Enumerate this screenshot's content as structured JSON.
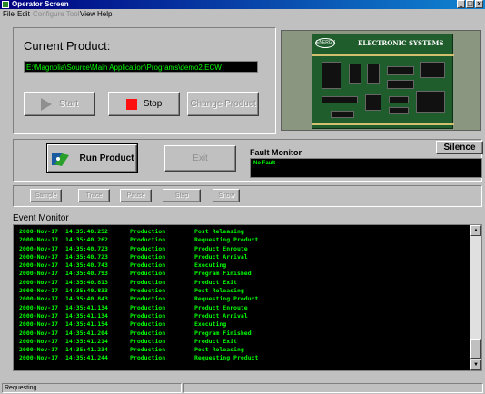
{
  "window": {
    "title": "Operator Screen",
    "min": "_",
    "max": "□",
    "close": "×"
  },
  "menu": {
    "items": [
      "File",
      "Edit",
      "Configure Tool",
      "View",
      "Help"
    ]
  },
  "product": {
    "label": "Current Product:",
    "path": "E:\\Magnolia\\Source\\Main Application\\Programs\\demo2.ECW",
    "image_brand": "ELECTRONIC SYSTEMS",
    "image_logo": "ENERGY"
  },
  "buttons": {
    "start": "Start",
    "stop": "Stop",
    "change_product": "Change Product",
    "run_product": "Run Product",
    "exit": "Exit",
    "silence": "Silence"
  },
  "fault": {
    "title": "Fault Monitor",
    "status": "No Fault"
  },
  "toolbar": {
    "buttons": [
      "Sample",
      "Trace",
      "Pause",
      "Step",
      "Show"
    ]
  },
  "events": {
    "title": "Event Monitor",
    "rows": [
      [
        "2000-Nov-17",
        "14:35:40.252",
        "Production",
        "Post Releasing"
      ],
      [
        "2000-Nov-17",
        "14:35:40.262",
        "Production",
        "Requesting Product"
      ],
      [
        "2000-Nov-17",
        "14:35:40.723",
        "Production",
        "Product Enroute"
      ],
      [
        "2000-Nov-17",
        "14:35:40.723",
        "Production",
        "Product Arrival"
      ],
      [
        "2000-Nov-17",
        "14:35:40.743",
        "Production",
        "Executing"
      ],
      [
        "2000-Nov-17",
        "14:35:40.793",
        "Production",
        "Program Finished"
      ],
      [
        "2000-Nov-17",
        "14:35:40.813",
        "Production",
        "Product Exit"
      ],
      [
        "2000-Nov-17",
        "14:35:40.833",
        "Production",
        "Post Releasing"
      ],
      [
        "2000-Nov-17",
        "14:35:40.843",
        "Production",
        "Requesting Product"
      ],
      [
        "2000-Nov-17",
        "14:35:41.134",
        "Production",
        "Product Enroute"
      ],
      [
        "2000-Nov-17",
        "14:35:41.134",
        "Production",
        "Product Arrival"
      ],
      [
        "2000-Nov-17",
        "14:35:41.154",
        "Production",
        "Executing"
      ],
      [
        "2000-Nov-17",
        "14:35:41.204",
        "Production",
        "Program Finished"
      ],
      [
        "2000-Nov-17",
        "14:35:41.214",
        "Production",
        "Product Exit"
      ],
      [
        "2000-Nov-17",
        "14:35:41.234",
        "Production",
        "Post Releasing"
      ],
      [
        "2000-Nov-17",
        "14:35:41.244",
        "Production",
        "Requesting Product"
      ]
    ]
  },
  "status": {
    "text": "Requesting"
  },
  "colors": {
    "console_bg": "#000000",
    "console_text": "#00ff00",
    "stop": "#ff1010",
    "titlebar": "#000080"
  }
}
